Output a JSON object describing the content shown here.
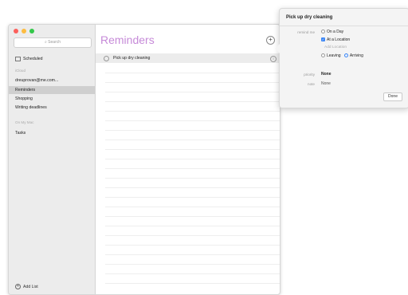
{
  "sidebar": {
    "search_placeholder": "Search",
    "scheduled": "Scheduled",
    "section_icloud": "iCloud",
    "account": "dreuprovan@me.com...",
    "lists": [
      "Reminders",
      "Shopping",
      "Writing deadlines"
    ],
    "section_on_my_mac": "On My Mac",
    "mac_lists": [
      "Tasks"
    ],
    "add_list": "Add List"
  },
  "main": {
    "title": "Reminders",
    "add_label": "+",
    "reminder": "Pick up dry cleaning"
  },
  "popover": {
    "title": "Pick up dry cleaning",
    "remind_me_label": "remind me",
    "on_a_day": "On a Day",
    "at_a_location": "At a Location",
    "add_location": "Add Location",
    "leaving": "Leaving",
    "arriving": "Arriving",
    "priority_label": "priority",
    "priority_value": "None",
    "note_label": "note",
    "note_value": "None",
    "done": "Done"
  },
  "colors": {
    "title": "#c68ad8",
    "accent": "#3d87f5"
  }
}
